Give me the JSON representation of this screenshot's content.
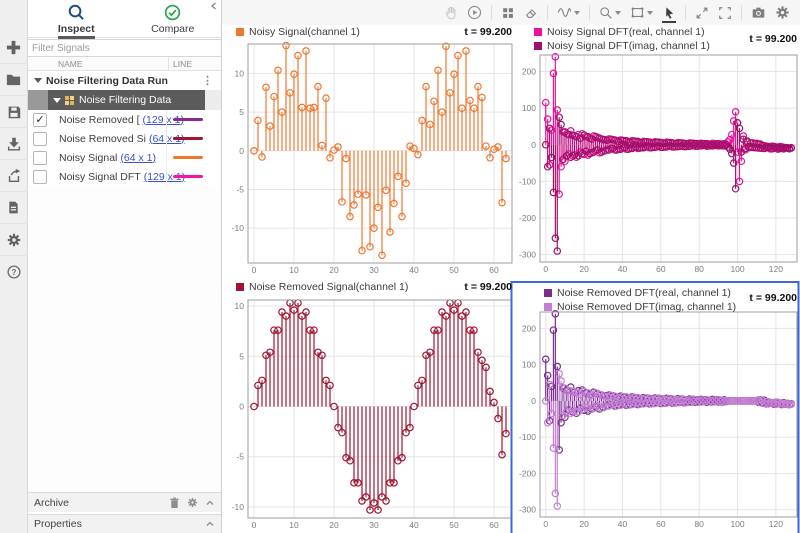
{
  "ui": {
    "selection_color": "#4166d8",
    "grid_color": "#e4e4e4",
    "frame_color": "#9e9e9e",
    "tick_color": "#7d7d7d"
  },
  "left_toolbar": {
    "buttons": [
      {
        "name": "new",
        "icon": "plus-icon"
      },
      {
        "name": "open",
        "icon": "folder-icon"
      },
      {
        "name": "save",
        "icon": "save-icon"
      },
      {
        "name": "import",
        "icon": "import-icon"
      },
      {
        "name": "export",
        "icon": "export-icon"
      },
      {
        "name": "report",
        "icon": "document-icon"
      },
      {
        "name": "preferences",
        "icon": "gear-icon"
      },
      {
        "name": "help",
        "icon": "help-icon"
      }
    ]
  },
  "signal_panel": {
    "tabs": [
      {
        "label": "Inspect",
        "active": true
      },
      {
        "label": "Compare",
        "active": false
      }
    ],
    "filter_placeholder": "Filter Signals",
    "columns": [
      "NAME",
      "LINE"
    ],
    "run_group": {
      "label": "Noise Filtering Data Run"
    },
    "data_group": {
      "label": "Noise Filtering Data"
    },
    "signals": [
      {
        "check_glyph": "✓",
        "label": "Noise Removed [",
        "dims": "(129 x 1)",
        "line_color": "#8a2a8f"
      },
      {
        "label": "Noise Removed Si",
        "dims": "(64 x 1)",
        "line_color": "#a2142f"
      },
      {
        "label": "Noisy Signal",
        "dims": "(64 x 1)",
        "line_color": "#f0772f"
      },
      {
        "label": "Noisy Signal DFT",
        "dims": "(129 x 1)",
        "line_color": "#f516a8"
      }
    ],
    "archive": {
      "label": "Archive"
    },
    "properties": {
      "label": "Properties"
    }
  },
  "chart_data": [
    {
      "type": "stem",
      "time_label": "t = 99.200",
      "x_start": 0,
      "x_step": 1,
      "xlim": [
        -1.5,
        64.5
      ],
      "ylim": [
        -14.5,
        13.8
      ],
      "xticks": [
        0,
        10,
        20,
        30,
        40,
        50,
        60
      ],
      "yticks": [
        -10,
        -5,
        0,
        5,
        10
      ],
      "series": [
        {
          "name": "Noisy Signal(channel 1)",
          "color": "#f0772f",
          "values": [
            0.0,
            3.9,
            -0.8,
            8.2,
            3.2,
            7.0,
            10.4,
            5.0,
            13.6,
            7.5,
            9.9,
            12.3,
            5.6,
            12.9,
            5.5,
            5.6,
            8.3,
            0.7,
            6.8,
            -0.9,
            0.1,
            0.5,
            -6.6,
            -1.0,
            -8.5,
            -7.0,
            -5.6,
            -12.9,
            -5.7,
            -12.4,
            -10.0,
            -7.3,
            -13.5,
            -5.1,
            -10.5,
            -6.8,
            -3.3,
            -8.5,
            -4.2,
            0.6,
            0.3,
            -0.5,
            3.9,
            8.3,
            3.4,
            6.4,
            10.4,
            5.0,
            13.5,
            7.5,
            9.9,
            12.3,
            5.5,
            12.9,
            6.5,
            5.5,
            8.3,
            6.9,
            0.6,
            -0.9,
            0.2,
            0.5,
            -6.7,
            -1.0
          ]
        }
      ]
    },
    {
      "type": "stem",
      "time_label": "t = 99.200",
      "x_start": 0,
      "x_step": 1,
      "xlim": [
        -3,
        131
      ],
      "ylim": [
        -320,
        245
      ],
      "xticks": [
        0,
        20,
        40,
        60,
        80,
        100,
        120
      ],
      "yticks": [
        -300,
        -200,
        -100,
        0,
        100,
        200
      ],
      "series": [
        {
          "name": "Noisy Signal DFT(real, channel 1)",
          "color": "#ec119b",
          "values": [
            115,
            70,
            -55,
            40,
            195,
            240,
            95,
            -135,
            -60,
            35,
            -45,
            30,
            -25,
            38,
            -30,
            24,
            -34,
            28,
            -20,
            30,
            -26,
            22,
            -28,
            18,
            -22,
            24,
            -16,
            20,
            -22,
            16,
            -18,
            14,
            -12,
            16,
            -10,
            14,
            -14,
            10,
            -12,
            13,
            -9,
            11,
            -12,
            8,
            -10,
            11,
            -8,
            9,
            -10,
            7,
            -8,
            9,
            -6,
            8,
            -8,
            6,
            -7,
            8,
            -5,
            7,
            -7,
            5,
            -6,
            7,
            -4,
            6,
            -6,
            4,
            -5,
            6,
            -4,
            5,
            -5,
            3,
            -4,
            5,
            -3,
            4,
            -4,
            3,
            -3,
            4,
            -2,
            3,
            -4,
            2,
            -3,
            4,
            -2,
            3,
            -3,
            2,
            -3,
            3,
            -2,
            8,
            14,
            28,
            65,
            90,
            -20,
            -100,
            -45,
            24,
            -14,
            10,
            -8,
            -6,
            5,
            -8,
            4,
            -9,
            2,
            -10,
            -3,
            -8,
            -5,
            -11,
            -4,
            -9,
            -6,
            -12,
            -5,
            -10,
            -7,
            -9,
            -8,
            -11,
            -9
          ]
        },
        {
          "name": "Noisy Signal DFT(imag, channel 1)",
          "color": "#9e1167",
          "values": [
            0,
            -60,
            45,
            -35,
            -130,
            -255,
            -290,
            75,
            55,
            -40,
            35,
            -30,
            28,
            -34,
            26,
            -28,
            22,
            -30,
            18,
            -24,
            26,
            -18,
            22,
            -24,
            16,
            -20,
            22,
            -14,
            18,
            -20,
            14,
            -16,
            12,
            -14,
            15,
            -10,
            13,
            -14,
            9,
            -12,
            12,
            -8,
            11,
            -12,
            7,
            -10,
            10,
            -7,
            9,
            -9,
            6,
            -8,
            8,
            -5,
            7,
            -8,
            5,
            -7,
            7,
            -4,
            6,
            -7,
            4,
            -6,
            6,
            -3,
            5,
            -6,
            3,
            -5,
            5,
            -3,
            4,
            -5,
            2,
            -4,
            4,
            -2,
            3,
            -4,
            2,
            -3,
            3,
            -2,
            3,
            -3,
            1,
            -3,
            2,
            -2,
            3,
            -2,
            2,
            -3,
            1,
            -6,
            -12,
            -24,
            -50,
            -120,
            60,
            45,
            -20,
            15,
            -10,
            8,
            -6,
            5,
            -7,
            3,
            -8,
            2,
            -9,
            -2,
            -10,
            -4,
            -8,
            -6,
            -11,
            -5,
            -9,
            -7,
            -10,
            -6,
            -11,
            -8,
            -9,
            -10,
            -8
          ]
        }
      ]
    },
    {
      "type": "stem",
      "time_label": "t = 99.200",
      "x_start": 0,
      "x_step": 1,
      "xlim": [
        -1.5,
        64.5
      ],
      "ylim": [
        -11.1,
        10.6
      ],
      "xticks": [
        0,
        10,
        20,
        30,
        40,
        50,
        60
      ],
      "yticks": [
        -10,
        -5,
        0,
        5,
        10
      ],
      "series": [
        {
          "name": "Noise Removed Signal(channel 1)",
          "color": "#a2142f",
          "values": [
            0.0,
            2.1,
            2.6,
            5.1,
            5.4,
            7.6,
            7.6,
            9.4,
            9.0,
            10.3,
            9.6,
            10.3,
            9.0,
            9.4,
            7.6,
            7.6,
            5.4,
            5.1,
            2.6,
            2.1,
            0.0,
            -2.1,
            -2.6,
            -5.1,
            -5.4,
            -7.6,
            -7.6,
            -9.4,
            -9.0,
            -10.3,
            -9.6,
            -10.3,
            -9.0,
            -9.4,
            -7.6,
            -7.6,
            -5.4,
            -5.1,
            -2.6,
            -2.1,
            0.0,
            2.1,
            2.6,
            5.1,
            5.4,
            7.6,
            7.6,
            9.4,
            9.0,
            10.3,
            9.6,
            10.3,
            9.0,
            9.4,
            7.6,
            7.6,
            5.4,
            4.6,
            3.9,
            1.5,
            0.4,
            -1.2,
            -4.8,
            -2.7
          ]
        }
      ]
    },
    {
      "type": "stem",
      "selected": true,
      "time_label": "t = 99.200",
      "x_start": 0,
      "x_step": 1,
      "xlim": [
        -3,
        131
      ],
      "ylim": [
        -320,
        245
      ],
      "xticks": [
        0,
        20,
        40,
        60,
        80,
        100,
        120
      ],
      "yticks": [
        -300,
        -200,
        -100,
        0,
        100,
        200
      ],
      "series": [
        {
          "name": "Noise Removed DFT(real, channel 1)",
          "color": "#7a2e8e",
          "values": [
            115,
            70,
            -55,
            40,
            195,
            240,
            95,
            -135,
            -60,
            35,
            -45,
            30,
            -25,
            38,
            -30,
            24,
            -34,
            28,
            -20,
            30,
            -26,
            22,
            -28,
            18,
            -22,
            24,
            -16,
            20,
            -22,
            16,
            -18,
            14,
            -12,
            16,
            -10,
            14,
            -14,
            10,
            -12,
            13,
            -9,
            11,
            -12,
            8,
            -10,
            11,
            -8,
            9,
            -10,
            7,
            -8,
            9,
            -6,
            8,
            -8,
            6,
            -7,
            8,
            -5,
            7,
            -7,
            5,
            -6,
            7,
            -4,
            6,
            -6,
            4,
            -5,
            6,
            -4,
            5,
            -5,
            3,
            -4,
            5,
            -3,
            4,
            -4,
            3,
            -3,
            4,
            -2,
            3,
            -4,
            2,
            -3,
            4,
            -2,
            3,
            -3,
            2,
            -3,
            3,
            -2,
            0,
            0,
            0,
            0,
            0,
            0,
            0,
            0,
            0,
            0,
            0,
            0,
            0,
            0,
            0,
            0,
            -4,
            3,
            -6,
            2,
            -8,
            -3,
            -6,
            -5,
            -9,
            -4,
            -8,
            -6,
            -10,
            -5,
            -9,
            -7,
            -10,
            -8
          ]
        },
        {
          "name": "Noise Removed DFT(imag, channel 1)",
          "color": "#c27fd4",
          "values": [
            0,
            -60,
            45,
            -35,
            -130,
            -255,
            -290,
            75,
            55,
            -40,
            35,
            -30,
            28,
            -34,
            26,
            -28,
            22,
            -30,
            18,
            -24,
            26,
            -18,
            22,
            -24,
            16,
            -20,
            22,
            -14,
            18,
            -20,
            14,
            -16,
            12,
            -14,
            15,
            -10,
            13,
            -14,
            9,
            -12,
            12,
            -8,
            11,
            -12,
            7,
            -10,
            10,
            -7,
            9,
            -9,
            6,
            -8,
            8,
            -5,
            7,
            -8,
            5,
            -7,
            7,
            -4,
            6,
            -7,
            4,
            -6,
            6,
            -3,
            5,
            -6,
            3,
            -5,
            5,
            -3,
            4,
            -5,
            2,
            -4,
            4,
            -2,
            3,
            -4,
            2,
            -3,
            3,
            -2,
            3,
            -3,
            1,
            -3,
            2,
            -2,
            3,
            -2,
            2,
            -3,
            1,
            0,
            0,
            0,
            0,
            0,
            0,
            0,
            0,
            0,
            0,
            0,
            0,
            0,
            0,
            0,
            0,
            3,
            -5,
            2,
            -7,
            -2,
            -8,
            -4,
            -6,
            -5,
            -9,
            -4,
            -8,
            -6,
            -9,
            -7,
            -10,
            -8,
            -9
          ]
        }
      ]
    }
  ]
}
